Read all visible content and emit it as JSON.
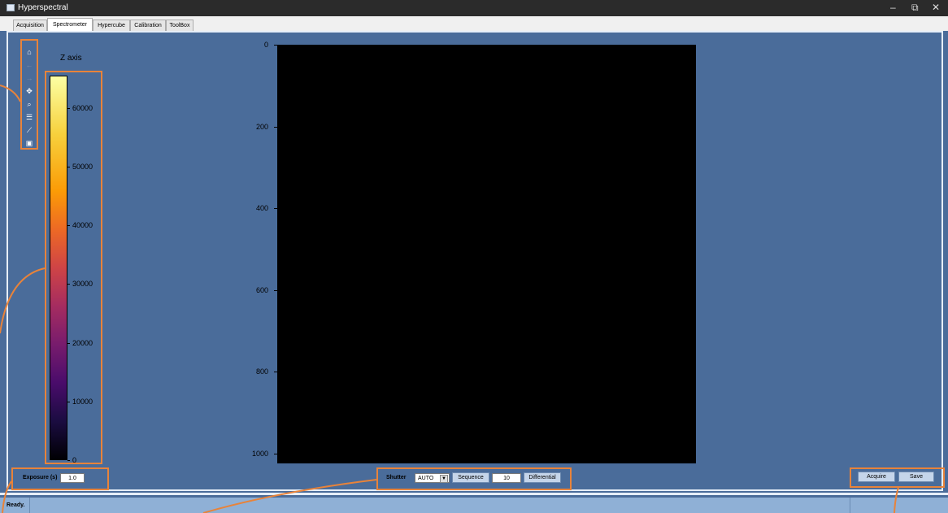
{
  "window": {
    "title": "Hyperspectral",
    "minimize_glyph": "–",
    "restore_glyph": "⧉",
    "close_glyph": "✕"
  },
  "tabs": [
    {
      "label": "Acquisition"
    },
    {
      "label": "Spectrometer",
      "active": true
    },
    {
      "label": "Hypercube"
    },
    {
      "label": "Calibration"
    },
    {
      "label": "ToolBox"
    }
  ],
  "toolbar": {
    "icons": [
      {
        "name": "home-icon",
        "glyph": "⌂",
        "enabled": true
      },
      {
        "name": "back-arrow-icon",
        "glyph": "←",
        "enabled": false
      },
      {
        "name": "forward-arrow-icon",
        "glyph": "→",
        "enabled": false
      },
      {
        "name": "pan-icon",
        "glyph": "✥",
        "enabled": true
      },
      {
        "name": "zoom-icon",
        "glyph": "⌕",
        "enabled": true
      },
      {
        "name": "configure-subplots-icon",
        "glyph": "☰",
        "enabled": true
      },
      {
        "name": "edit-axis-icon",
        "glyph": "⟋",
        "enabled": true
      },
      {
        "name": "save-figure-icon",
        "glyph": "▣",
        "enabled": true
      }
    ]
  },
  "colorbar": {
    "label": "Z axis",
    "colormap": "inferno",
    "range": [
      0,
      65535
    ],
    "ticks": [
      "0",
      "10000",
      "20000",
      "30000",
      "40000",
      "50000",
      "60000"
    ]
  },
  "image_axis": {
    "y_ticks": [
      "0",
      "200",
      "400",
      "600",
      "800",
      "1000"
    ],
    "y_range": [
      0,
      1024
    ],
    "background": "#000000"
  },
  "controls": {
    "exposure_label": "Exposure (s)",
    "exposure_value": "1.0",
    "shutter_label": "Shutter",
    "shutter_value": "AUTO",
    "sequence_label": "Sequence",
    "sequence_value": "10",
    "differential_label": "Differential",
    "acquire_label": "Acquire",
    "save_label": "Save"
  },
  "status": {
    "text": "Ready."
  },
  "colors": {
    "highlight": "#e8833a",
    "panel": "#4a6c9a",
    "statusbar": "#8fb0d6"
  }
}
